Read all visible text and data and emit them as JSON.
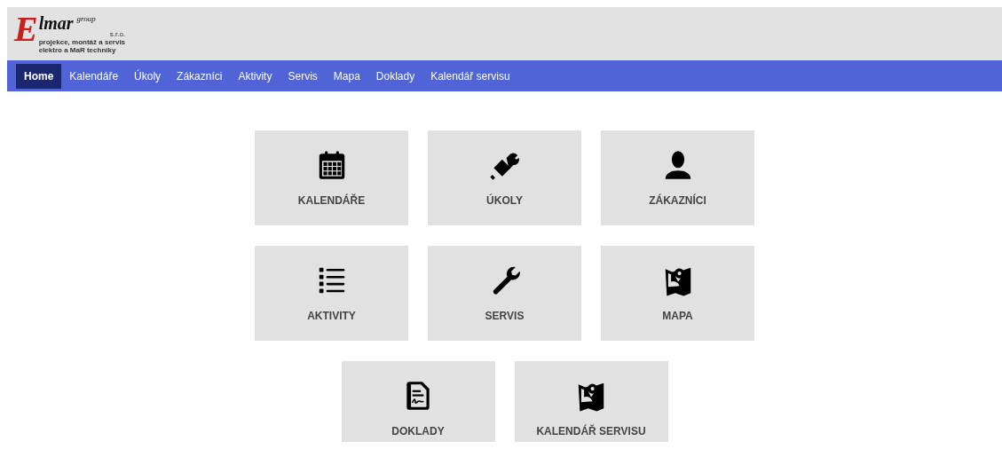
{
  "logo": {
    "initial": "E",
    "name": "lmar",
    "group": "group",
    "suffix": "s.r.o.",
    "tagline": [
      "projekce, montáž a servis",
      "elektro a MaR techniky"
    ]
  },
  "nav": [
    {
      "label": "Home",
      "selected": true
    },
    {
      "label": "Kalendáře",
      "selected": false
    },
    {
      "label": "Úkoly",
      "selected": false
    },
    {
      "label": "Zákazníci",
      "selected": false
    },
    {
      "label": "Aktivity",
      "selected": false
    },
    {
      "label": "Servis",
      "selected": false
    },
    {
      "label": "Mapa",
      "selected": false
    },
    {
      "label": "Doklady",
      "selected": false
    },
    {
      "label": "Kalendář servisu",
      "selected": false
    }
  ],
  "tiles": [
    [
      {
        "label": "KALENDÁŘE",
        "kind": "calendar"
      },
      {
        "label": "ÚKOLY",
        "kind": "tasks"
      },
      {
        "label": "ZÁKAZNÍCI",
        "kind": "person"
      }
    ],
    [
      {
        "label": "AKTIVITY",
        "kind": "list"
      },
      {
        "label": "SERVIS",
        "kind": "wrench"
      },
      {
        "label": "MAPA",
        "kind": "map"
      }
    ],
    [
      {
        "label": "DOKLADY",
        "kind": "document"
      },
      {
        "label": "KALENDÁŘ SERVISU",
        "kind": "map"
      }
    ]
  ]
}
